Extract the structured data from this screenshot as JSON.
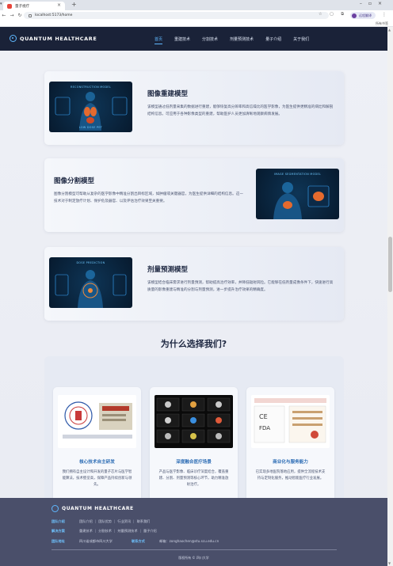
{
  "browser": {
    "tab_title": "量子视疗",
    "url": "localhost:5173/home",
    "profile_label": "远程翻译",
    "bookmarks_label": "所有书签"
  },
  "nav": {
    "brand": "QUANTUM HEALTHCARE",
    "links": [
      "首页",
      "重建技术",
      "分割技术",
      "剂量预测技术",
      "量子介绍",
      "关于我们"
    ],
    "active_index": 0
  },
  "models": [
    {
      "title": "图像重建模型",
      "image_caption_top": "RECONSTRUCTION MODEL",
      "image_caption_bottom": "LOW DOSE PET",
      "description": "该模型通过低剂量采集的数据进行重建，能够恢复高分辨率和高信噪比的医学影像，为医生提供更精准的病灶和解剖结构信息。可应用于各种影像类型的重建，帮助医护人员更加清晰地观察病情发展。"
    },
    {
      "title": "图像分割模型",
      "image_caption_top": "IMAGE SEGMENTATION MODEL",
      "description": "图像分割模型可帮助从复杂的医学影像中精准分割出目标区域，如肿瘤或关键器官，为医生提供详细的结构信息。这一技术对于制定放疗计划、保护危及器官、以及评估治疗效果至关重要。"
    },
    {
      "title": "剂量预测模型",
      "image_caption_top": "DOSE PREDICTION",
      "description": "该模型结合临床需求进行剂量预测，帮助提高治疗效率，并降低辐射风险。它能够在低剂量成像条件下，快速进行高质量的影像重建与精准的分割与剂量预测，进一步提升治疗效果的精确度。"
    }
  ],
  "why": {
    "title": "为什么选择我们?",
    "features": [
      {
        "title": "核心技术自主研发",
        "description": "我们拥有自主设计和开发的量子芯片与医学智能算法，技术壁垒高，保障产品持续创新与领先。"
      },
      {
        "title": "深度融合医疗场景",
        "description": "产品与医学影像、临床诊疗深度结合，覆盖重建、分割、剂量预测等核心环节，助力精准放射治疗。"
      },
      {
        "title": "商业化与服务能力",
        "description": "已实现多地医院落地应用，提供全流程技术支持与定制化服务，推动智能医疗行业发展。"
      }
    ]
  },
  "footer": {
    "brand": "QUANTUM HEALTHCARE",
    "row1_label": "团队介绍",
    "row1_items": [
      "团队介绍",
      "团队优势",
      "行业资讯",
      "联系我们"
    ],
    "row2_label": "解决方案",
    "row2_items": [
      "重建技术",
      "分割技术",
      "剂量预测技术",
      "量子介绍"
    ],
    "row3_label": "团队地址",
    "row3_value": "四川省成都市四川大学",
    "row3_label2": "联系方式",
    "row3_email_label": "邮箱：",
    "row3_email": "zonghaochen@stu.scu.edu.cn",
    "copyright": "版权所有 © 四川大学"
  },
  "colors": {
    "nav_bg": "#1a2238",
    "accent": "#5fb8ff",
    "feature_title": "#2d6db5",
    "footer_bg": "#4a4f6a"
  }
}
